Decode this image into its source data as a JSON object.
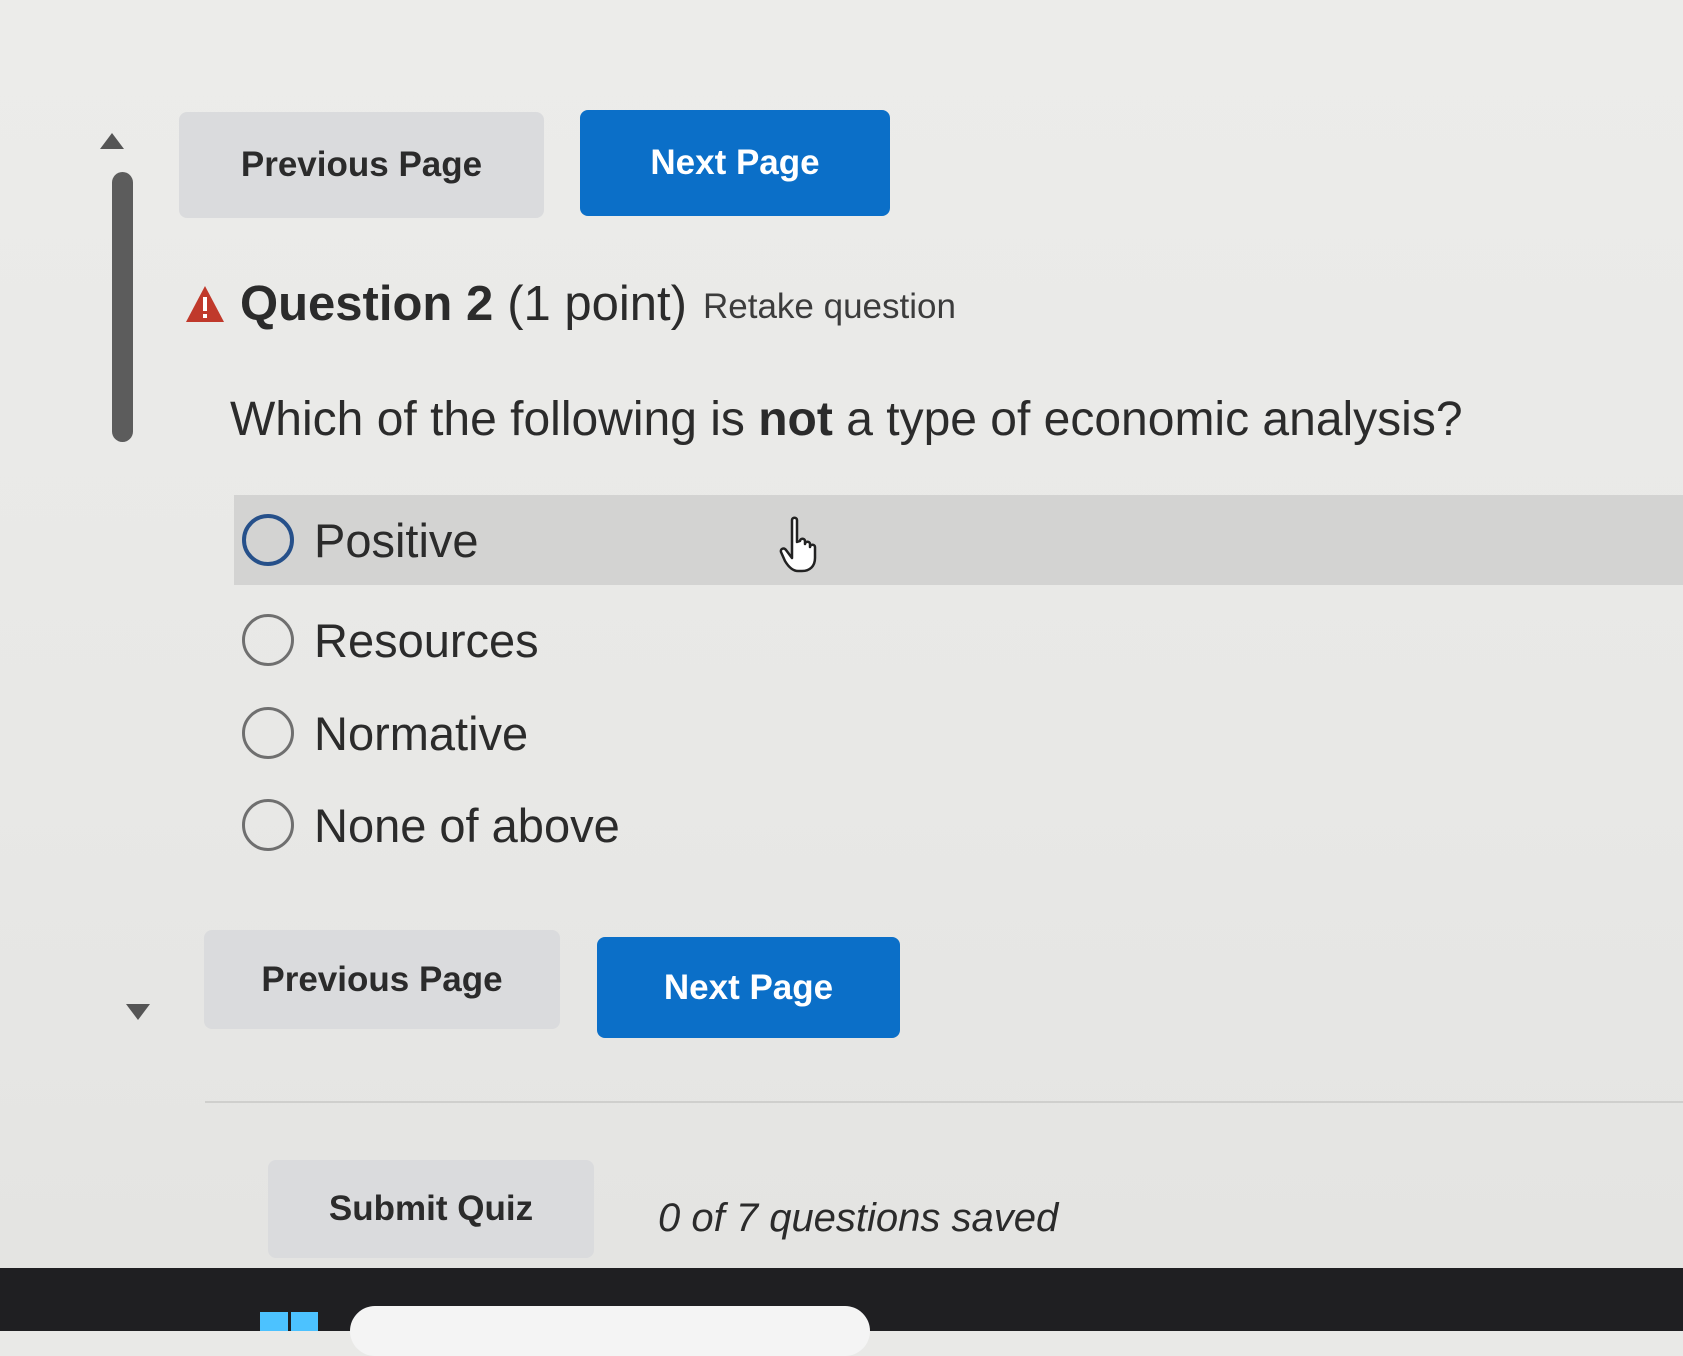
{
  "nav_top": {
    "previous_label": "Previous Page",
    "next_label": "Next Page"
  },
  "question": {
    "title": "Question 2",
    "points": "(1 point)",
    "retake": "Retake question",
    "prompt_before": "Which of the following is ",
    "prompt_emphasis": "not",
    "prompt_after": " a type of economic analysis?",
    "options": [
      {
        "label": "Positive"
      },
      {
        "label": "Resources"
      },
      {
        "label": "Normative"
      },
      {
        "label": "None of above"
      }
    ]
  },
  "nav_bottom": {
    "previous_label": "Previous Page",
    "next_label": "Next Page"
  },
  "footer": {
    "submit_label": "Submit Quiz",
    "saved_status": "0 of 7 questions saved"
  },
  "colors": {
    "primary": "#0b6fc8",
    "warning": "#c0392b",
    "secondary": "#dadbdd"
  },
  "icons": {
    "warning": "warning-triangle-icon",
    "cursor": "hand-pointer-icon"
  }
}
